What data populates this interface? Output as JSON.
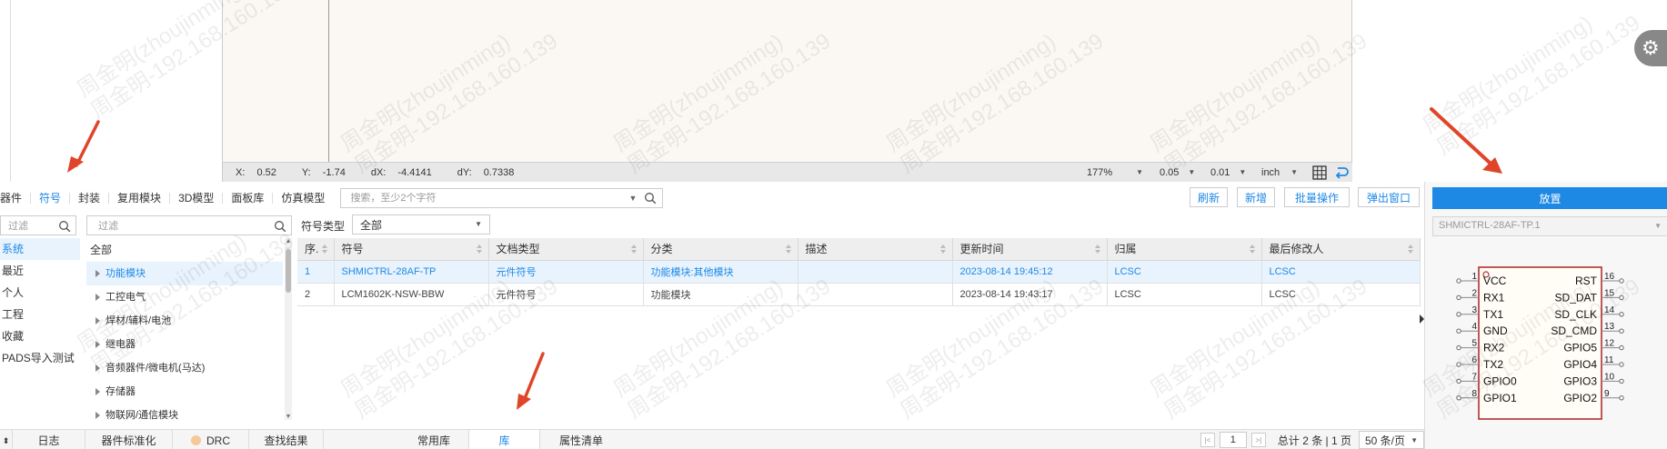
{
  "status": {
    "x_label": "X:",
    "x_value": "0.52",
    "y_label": "Y:",
    "y_value": "-1.74",
    "dx_label": "dX:",
    "dx_value": "-4.4141",
    "dy_label": "dY:",
    "dy_value": "0.7338",
    "zoom": "177%",
    "grid": "0.05",
    "snap": "0.01",
    "unit": "inch"
  },
  "toolbar": {
    "tabs": [
      "器件",
      "符号",
      "封装",
      "复用模块",
      "3D模型",
      "面板库",
      "仿真模型"
    ],
    "active_tab": "符号",
    "search_placeholder": "搜索，至少2个字符",
    "buttons": [
      "刷新",
      "新增",
      "批量操作",
      "弹出窗口"
    ]
  },
  "filter1_placeholder": "过滤",
  "filter2_placeholder": "过滤",
  "categories": [
    "系统",
    "最近",
    "个人",
    "工程",
    "收藏",
    "PADS导入测试"
  ],
  "tree": {
    "root": "全部",
    "items": [
      "功能模块",
      "工控电气",
      "焊材/辅料/电池",
      "继电器",
      "音频器件/微电机(马达)",
      "存储器",
      "物联网/通信模块"
    ]
  },
  "symbol_type": {
    "label": "符号类型",
    "value": "全部"
  },
  "table": {
    "headers": [
      "序.",
      "符号",
      "文档类型",
      "分类",
      "描述",
      "更新时间",
      "归属",
      "最后修改人"
    ],
    "rows": [
      [
        "1",
        "SHMICTRL-28AF-TP",
        "元件符号",
        "功能模块:其他模块",
        "",
        "2023-08-14 19:45:12",
        "LCSC",
        "LCSC"
      ],
      [
        "2",
        "LCM1602K-NSW-BBW",
        "元件符号",
        "功能模块",
        "",
        "2023-08-14 19:43:17",
        "LCSC",
        "LCSC"
      ]
    ]
  },
  "bottom_tabs": [
    "日志",
    "器件标准化",
    "DRC",
    "查找结果",
    "常用库",
    "库",
    "属性清单"
  ],
  "active_bottom_tab": "库",
  "pager": {
    "page": "1",
    "total": "总计 2 条 | 1 页",
    "page_size": "50 条/页"
  },
  "right_panel": {
    "place_label": "放置",
    "selected_symbol": "SHMICTRL-28AF-TP.1"
  },
  "symbol_preview": {
    "left_pins": [
      {
        "num": "1",
        "name": "VCC"
      },
      {
        "num": "2",
        "name": "RX1"
      },
      {
        "num": "3",
        "name": "TX1"
      },
      {
        "num": "4",
        "name": "GND"
      },
      {
        "num": "5",
        "name": "RX2"
      },
      {
        "num": "6",
        "name": "TX2"
      },
      {
        "num": "7",
        "name": "GPIO0"
      },
      {
        "num": "8",
        "name": "GPIO1"
      }
    ],
    "right_pins": [
      {
        "num": "16",
        "name": "RST"
      },
      {
        "num": "15",
        "name": "SD_DAT"
      },
      {
        "num": "14",
        "name": "SD_CLK"
      },
      {
        "num": "13",
        "name": "SD_CMD"
      },
      {
        "num": "12",
        "name": "GPIO5"
      },
      {
        "num": "11",
        "name": "GPIO4"
      },
      {
        "num": "10",
        "name": "GPIO3"
      },
      {
        "num": "9",
        "name": "GPIO2"
      }
    ]
  },
  "watermark": {
    "line1": "周金明(zhoujinming)",
    "line2": "周金明-192.168.160.139"
  },
  "colors": {
    "accent": "#1e88e5",
    "arrow": "#e0452a",
    "pin_body": "#b03030"
  }
}
